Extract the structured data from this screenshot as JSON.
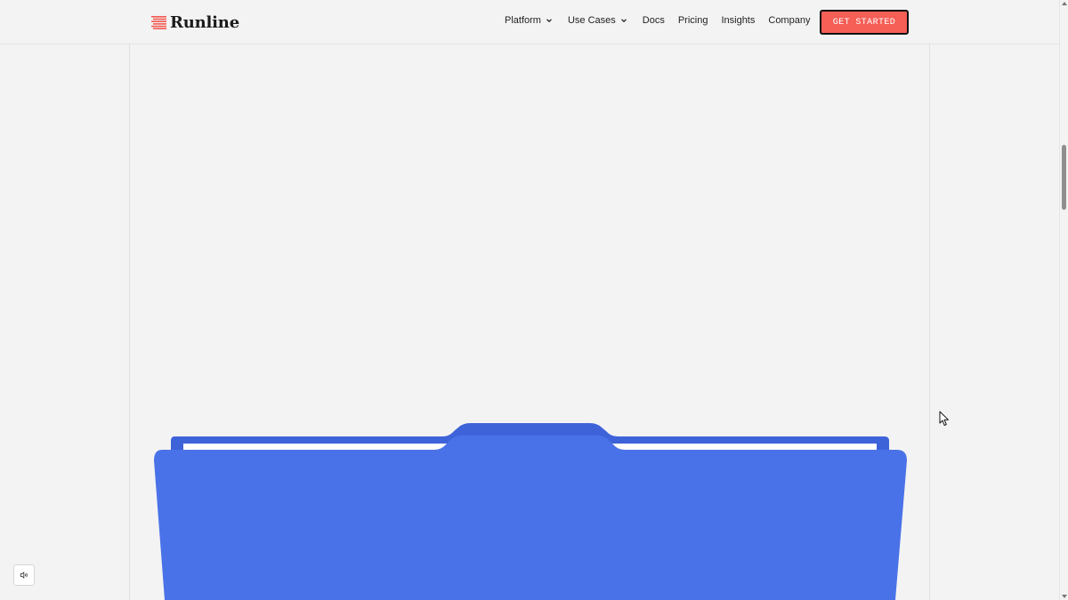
{
  "header": {
    "brand": "Runline",
    "nav": [
      {
        "label": "Platform",
        "has_dropdown": true
      },
      {
        "label": "Use Cases",
        "has_dropdown": true
      },
      {
        "label": "Docs",
        "has_dropdown": false
      },
      {
        "label": "Pricing",
        "has_dropdown": false
      },
      {
        "label": "Insights",
        "has_dropdown": false
      },
      {
        "label": "Company",
        "has_dropdown": false
      }
    ],
    "cta_label": "GET STARTED"
  },
  "icons": {
    "logo": "logo-stripes-icon",
    "dropdown": "chevron-down-icon",
    "sound": "speaker-icon",
    "cursor": "mouse-pointer-icon",
    "hero_graphic": "folder-illustration"
  },
  "colors": {
    "page_bg": "#f3f3f3",
    "brand_red": "#f55f56",
    "folder_front": "#4a72e8",
    "folder_back": "#3e63d9",
    "text": "#1f1f1f"
  }
}
